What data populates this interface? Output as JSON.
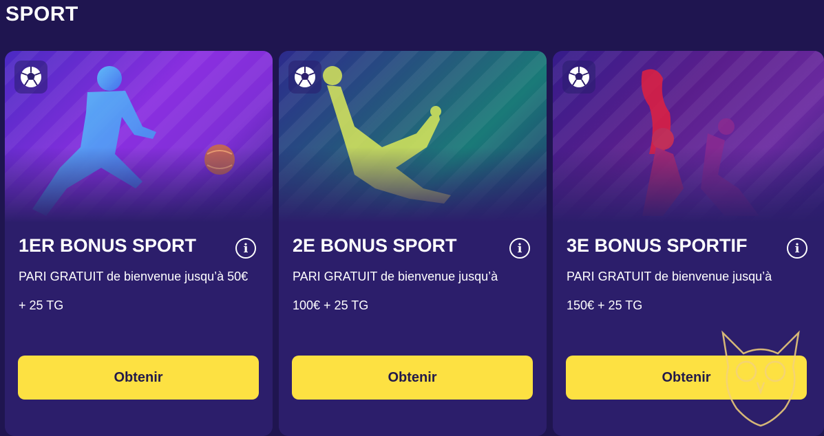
{
  "section": {
    "title": "SPORT"
  },
  "cards": [
    {
      "title": "1ER BONUS SPORT",
      "line1": "PARI GRATUIT de bienvenue jusqu’à 50€",
      "line2": "+ 25 TG",
      "button": "Obtenir",
      "sport_icon": "soccer-ball-icon",
      "info_icon": "info-icon",
      "info_glyph": "i"
    },
    {
      "title": "2E BONUS SPORT",
      "line1": "PARI GRATUIT de bienvenue jusqu’à",
      "line2": "100€ + 25 TG",
      "button": "Obtenir",
      "sport_icon": "soccer-ball-icon",
      "info_icon": "info-icon",
      "info_glyph": "i"
    },
    {
      "title": "3E BONUS SPORTIF",
      "line1": "PARI GRATUIT de bienvenue jusqu’à",
      "line2": "150€ + 25 TG",
      "button": "Obtenir",
      "sport_icon": "soccer-ball-icon",
      "info_icon": "info-icon",
      "info_glyph": "i"
    }
  ],
  "colors": {
    "background": "#1f1550",
    "card": "#2c1e6b",
    "button": "#fde142",
    "button_text": "#221a4a"
  }
}
